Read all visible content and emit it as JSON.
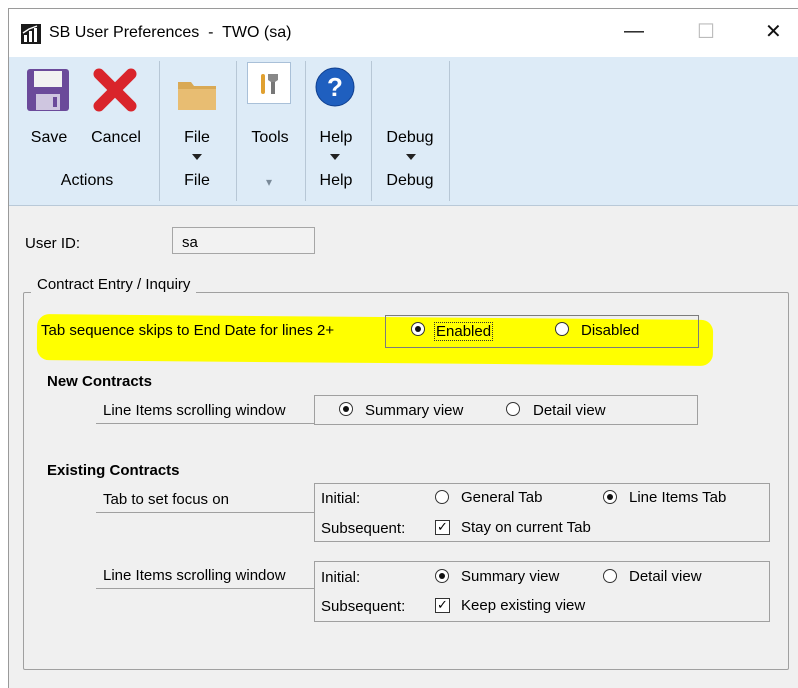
{
  "window": {
    "title": "SB User Preferences  -  TWO (sa)",
    "minimize_glyph": "—",
    "maximize_glyph": "☐",
    "close_glyph": "✕"
  },
  "ribbon": {
    "save_label": "Save",
    "cancel_label": "Cancel",
    "file_label": "File",
    "tools_label": "Tools",
    "help_label": "Help",
    "debug_label": "Debug",
    "groups": {
      "actions": "Actions",
      "file": "File",
      "tools_arrow": "▾",
      "help": "Help",
      "debug": "Debug"
    }
  },
  "form": {
    "user_id_label": "User ID:",
    "user_id_value": "sa",
    "contract_group_label": "Contract Entry / Inquiry",
    "tab_sequence_label": "Tab sequence skips to End Date for lines 2+",
    "tab_sequence_enabled": "Enabled",
    "tab_sequence_disabled": "Disabled",
    "tab_sequence_selected": "Enabled",
    "new_contracts_heading": "New Contracts",
    "new_scroll_label": "Line Items scrolling window",
    "new_scroll_summary": "Summary view",
    "new_scroll_detail": "Detail view",
    "new_scroll_selected": "Summary view",
    "existing_heading": "Existing Contracts",
    "focus_label": "Tab to set focus on",
    "focus_initial_label": "Initial:",
    "focus_general": "General Tab",
    "focus_line_items": "Line Items Tab",
    "focus_initial_selected": "Line Items Tab",
    "focus_subsequent_label": "Subsequent:",
    "focus_stay": "Stay on current Tab",
    "focus_stay_checked": true,
    "exist_scroll_label": "Line Items scrolling window",
    "exist_initial_label": "Initial:",
    "exist_summary": "Summary view",
    "exist_detail": "Detail view",
    "exist_initial_selected": "Summary view",
    "exist_subsequent_label": "Subsequent:",
    "exist_keep": "Keep existing view",
    "exist_keep_checked": true
  },
  "colors": {
    "ribbon_bg": "#ddebf7",
    "highlight": "#ffff00",
    "help_blue": "#1f5fbf",
    "cancel_red": "#d9242b",
    "save_purple": "#6b4a9a",
    "folder": "#e2b66a"
  }
}
